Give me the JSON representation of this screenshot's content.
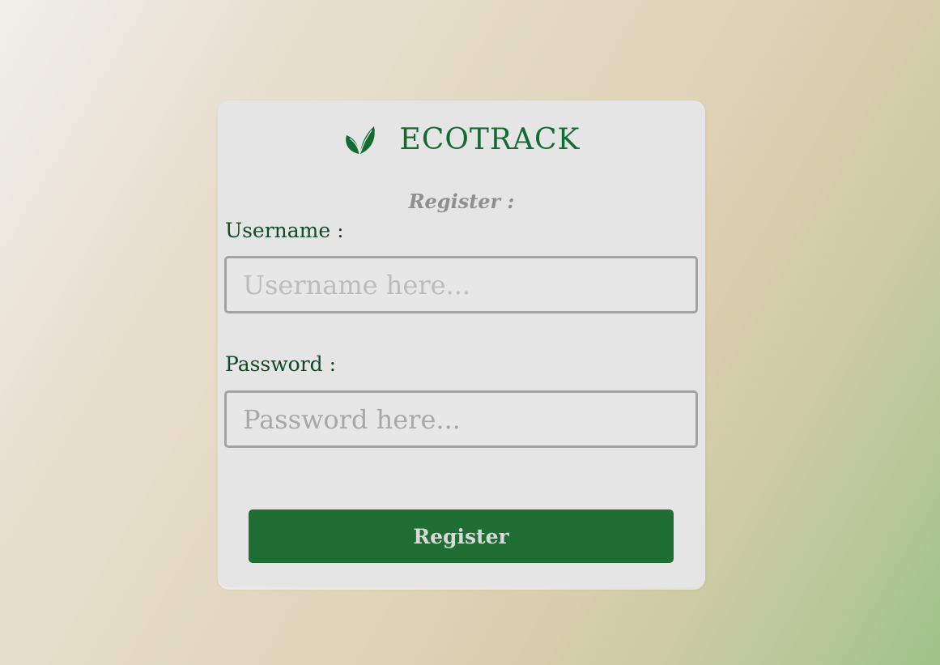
{
  "brand": {
    "logo_icon": "leaf-icon",
    "name": "ECOTRACK",
    "color": "#126b30"
  },
  "form": {
    "title": "Register :",
    "username": {
      "label": "Username :",
      "placeholder": "Username here...",
      "value": ""
    },
    "password": {
      "label": "Password :",
      "placeholder": "Password here...",
      "value": ""
    },
    "submit_label": "Register"
  },
  "colors": {
    "accent": "#1f6e33",
    "label": "#0f4a22",
    "card_bg": "#e5e5e5"
  }
}
